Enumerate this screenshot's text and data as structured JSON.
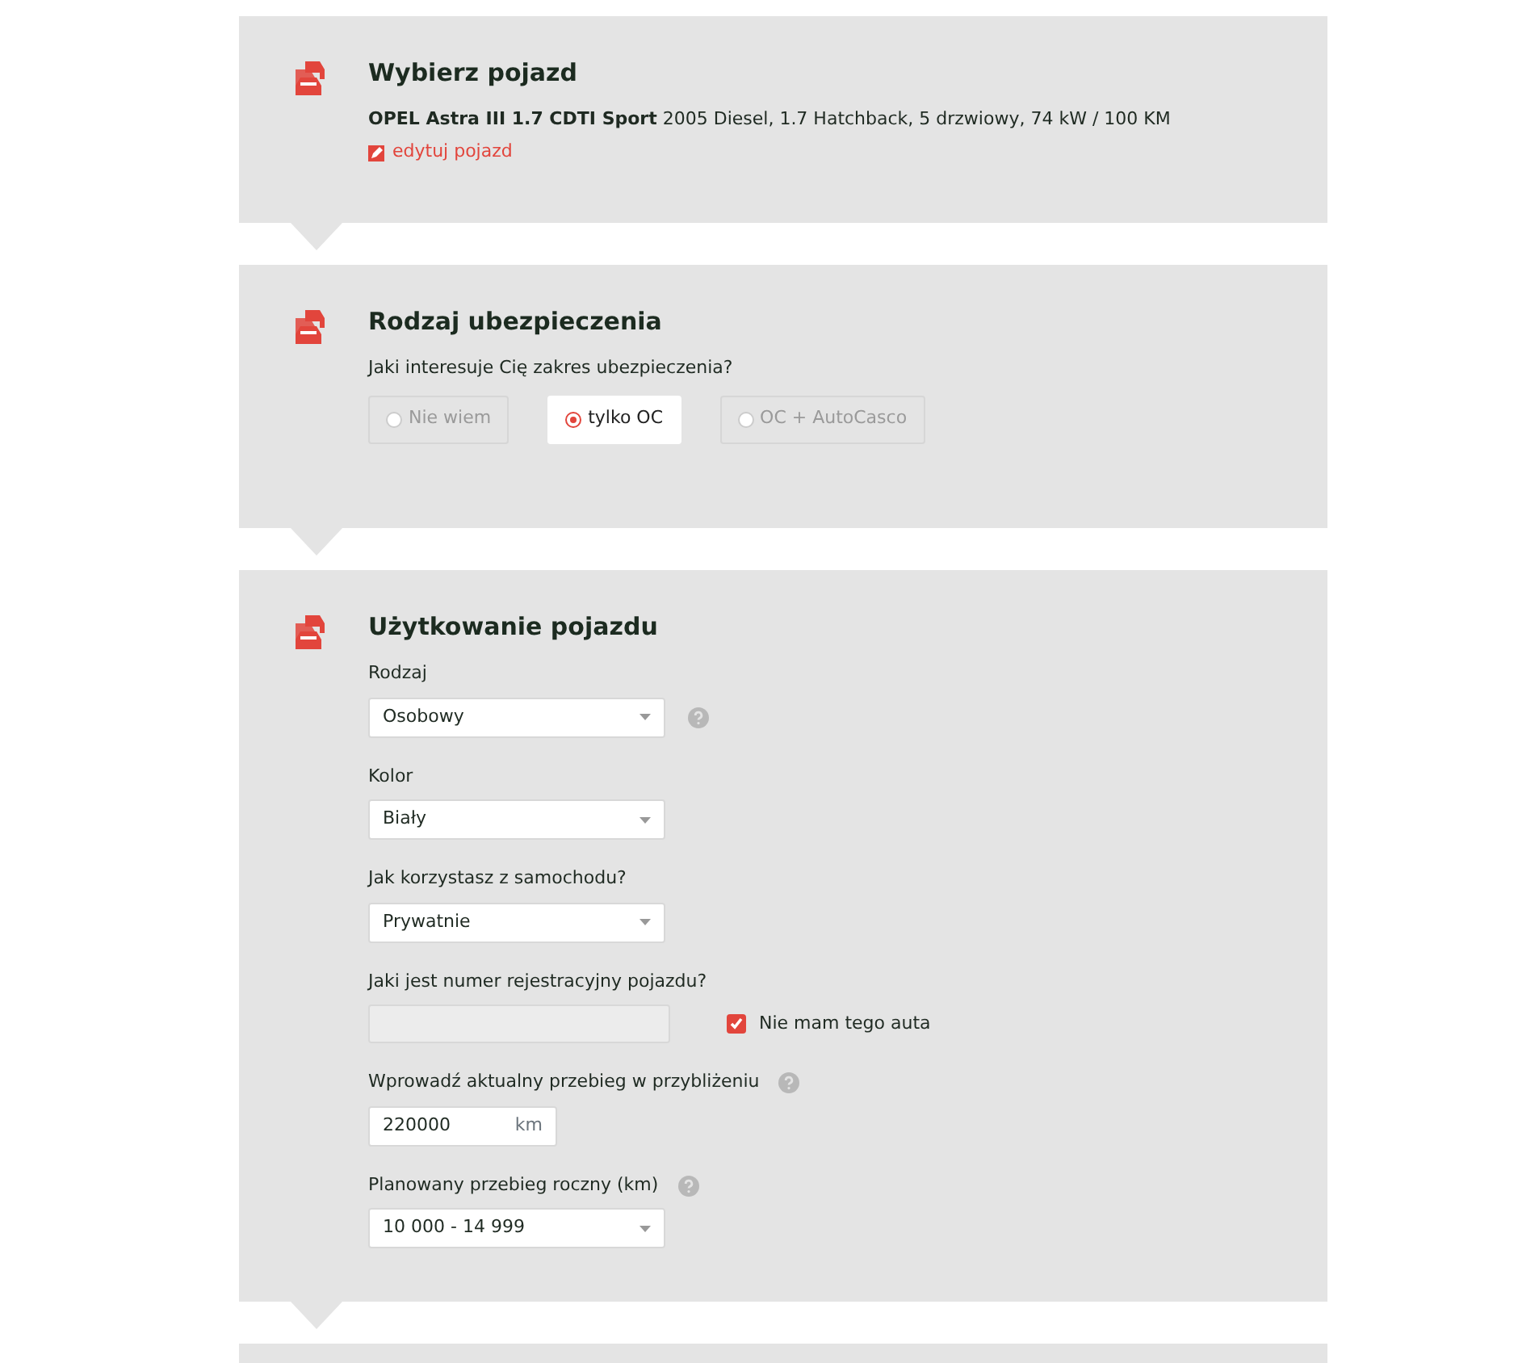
{
  "sections": [
    {
      "kind": "vehicle",
      "title": "Wybierz pojazd",
      "vehicle_name": "OPEL Astra III 1.7 CDTI Sport",
      "vehicle_details": "2005 Diesel, 1.7 Hatchback, 5 drzwiowy, 74 kW / 100 KM",
      "edit_link": "edytuj pojazd"
    },
    {
      "kind": "insurance",
      "title": "Rodzaj ubezpieczenia",
      "question": "Jaki interesuje Cię zakres ubezpieczenia?",
      "options": [
        {
          "label": "Nie wiem",
          "selected": false
        },
        {
          "label": "tylko OC",
          "selected": true
        },
        {
          "label": "OC + AutoCasco",
          "selected": false
        }
      ]
    },
    {
      "kind": "usage",
      "title": "Użytkowanie pojazdu",
      "fields": [
        {
          "kind": "select",
          "label": "Rodzaj",
          "value": "Osobowy",
          "help": true
        },
        {
          "kind": "select",
          "label": "Kolor",
          "value": "Biały",
          "help": false
        },
        {
          "kind": "select",
          "label": "Jak korzystasz z samochodu?",
          "value": "Prywatnie",
          "help": false
        },
        {
          "kind": "text",
          "label": "Jaki jest numer rejestracyjny pojazdu?",
          "disabled": true,
          "help": false,
          "checkbox": {
            "label": "Nie mam tego auta",
            "checked": true
          }
        },
        {
          "kind": "unit",
          "label": "Wprowadź aktualny przebieg w przybliżeniu",
          "value": "220000",
          "unit": "km",
          "help": true
        },
        {
          "kind": "select",
          "label": "Planowany przebieg roczny (km)",
          "value": "10 000 - 14 999",
          "help": true
        }
      ]
    },
    {
      "kind": "empty"
    }
  ]
}
